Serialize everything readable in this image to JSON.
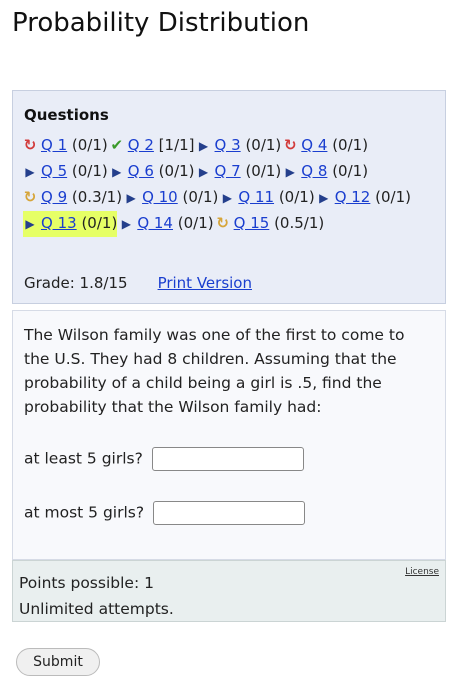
{
  "page_title": "Probability Distribution",
  "questions_heading": "Questions",
  "questions": [
    {
      "status": "redo",
      "label": "Q 1",
      "score": "(0/1)"
    },
    {
      "status": "correct",
      "label": "Q 2",
      "score": "[1/1]"
    },
    {
      "status": "unanswered",
      "label": "Q 3",
      "score": "(0/1)"
    },
    {
      "status": "redo",
      "label": "Q 4",
      "score": "(0/1)"
    },
    {
      "status": "unanswered",
      "label": "Q 5",
      "score": "(0/1)"
    },
    {
      "status": "unanswered",
      "label": "Q 6",
      "score": "(0/1)"
    },
    {
      "status": "unanswered",
      "label": "Q 7",
      "score": "(0/1)"
    },
    {
      "status": "unanswered",
      "label": "Q 8",
      "score": "(0/1)"
    },
    {
      "status": "partial",
      "label": "Q 9",
      "score": "(0.3/1)"
    },
    {
      "status": "unanswered",
      "label": "Q 10",
      "score": "(0/1)"
    },
    {
      "status": "unanswered",
      "label": "Q 11",
      "score": "(0/1)"
    },
    {
      "status": "unanswered",
      "label": "Q 12",
      "score": "(0/1)"
    },
    {
      "status": "current",
      "label": "Q 13",
      "score": "(0/1)"
    },
    {
      "status": "unanswered",
      "label": "Q 14",
      "score": "(0/1)"
    },
    {
      "status": "partial",
      "label": "Q 15",
      "score": "(0.5/1)"
    }
  ],
  "grade_text": "Grade: 1.8/15",
  "print_version": "Print Version",
  "question_text": "The Wilson family was one of the first to come to the U.S. They had 8 children. Assuming that the probability of a child being a girl is .5, find the probability that the Wilson family had:",
  "parts": [
    {
      "label": "at least 5 girls?",
      "value": ""
    },
    {
      "label": "at most 5 girls?",
      "value": ""
    }
  ],
  "points_possible": "Points possible: 1",
  "attempts": "Unlimited attempts.",
  "license": "License",
  "submit": "Submit"
}
